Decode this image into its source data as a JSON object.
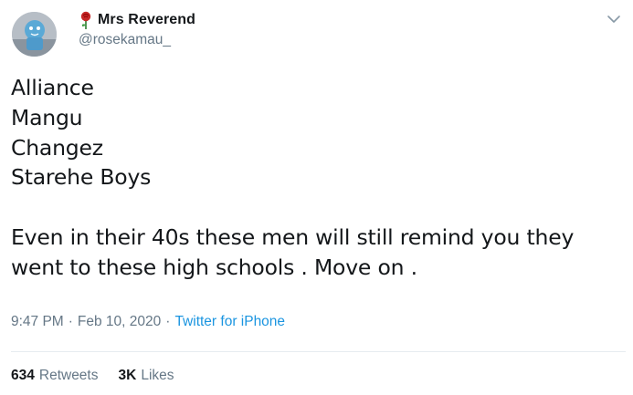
{
  "author": {
    "display_name": "Mrs Reverend",
    "handle": "@rosekamau_",
    "name_emoji": "rose-icon",
    "avatar": "avatar-icon"
  },
  "menu": {
    "icon": "chevron-down-icon"
  },
  "tweet": {
    "text": "Alliance\nMangu\nChangez\nStarehe Boys\n\nEven in their 40s these men will still remind you they\nwent to these high schools . Move on ."
  },
  "meta": {
    "time": "9:47 PM",
    "separator1": "·",
    "date": "Feb 10, 2020",
    "separator2": "·",
    "source": "Twitter for iPhone"
  },
  "stats": {
    "retweets_count": "634",
    "retweets_label": "Retweets",
    "likes_count": "3K",
    "likes_label": "Likes"
  },
  "colors": {
    "link": "#1b95e0",
    "secondary_text": "#657786",
    "primary_text": "#14171a",
    "divider": "#e6ecf0"
  }
}
